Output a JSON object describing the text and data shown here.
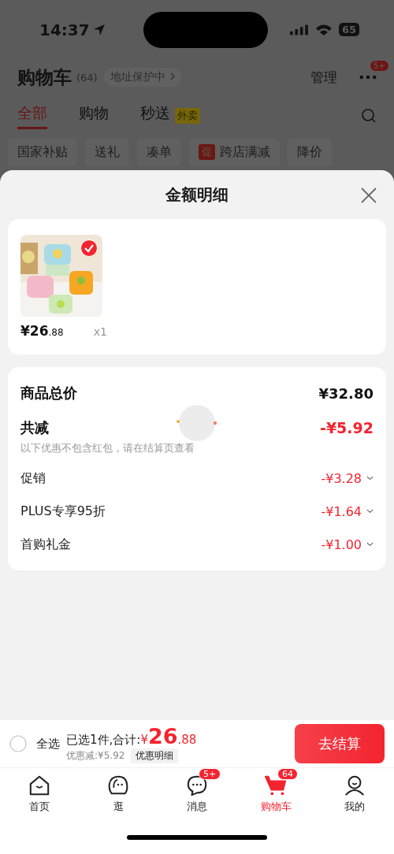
{
  "status_bar": {
    "time": "14:37",
    "battery": "65"
  },
  "header": {
    "title": "购物车",
    "count": "(64)",
    "address": "地址保护中",
    "manage": "管理",
    "more_badge": "5+"
  },
  "tabs": [
    {
      "label": "全部",
      "selected": true
    },
    {
      "label": "购物",
      "selected": false
    },
    {
      "label": "秒送",
      "selected": false,
      "tag": "外卖"
    }
  ],
  "chips": [
    {
      "label": "国家补贴"
    },
    {
      "label": "送礼"
    },
    {
      "label": "凑单"
    },
    {
      "label": "跨店满减",
      "badge": "促"
    },
    {
      "label": "降价"
    }
  ],
  "sheet": {
    "title": "金额明细",
    "items": [
      {
        "kind": "picture",
        "checked": true,
        "currency": "¥",
        "price": "26",
        "decimal": ".88",
        "quantity": "x1"
      }
    ],
    "total": {
      "label": "商品总价",
      "value": "¥32.80"
    },
    "reduction": {
      "label": "共减",
      "value": "-¥5.92",
      "note": "以下优惠不包含红包，请在结算页查看"
    },
    "discounts": [
      {
        "label": "促销",
        "value": "-¥3.28"
      },
      {
        "label": "PLUS专享95折",
        "value": "-¥1.64"
      },
      {
        "label": "首购礼金",
        "value": "-¥1.00"
      }
    ]
  },
  "bottom_bar": {
    "select_all": {
      "label": "全选",
      "checked": false
    },
    "selected_text": "已选1件,合计:",
    "currency": "¥",
    "amount": "26",
    "decimal": ".88",
    "discount": "优惠减:¥5.92",
    "detail_button": "优惠明细",
    "checkout": "去结算"
  },
  "nav": [
    {
      "label": "首页",
      "kind": "home",
      "selected": false
    },
    {
      "label": "逛",
      "kind": "face",
      "selected": false
    },
    {
      "label": "消息",
      "kind": "chat",
      "selected": false,
      "badge": "5+"
    },
    {
      "label": "购物车",
      "kind": "cart",
      "selected": true,
      "badge": "64"
    },
    {
      "label": "我的",
      "kind": "person",
      "selected": false
    }
  ]
}
